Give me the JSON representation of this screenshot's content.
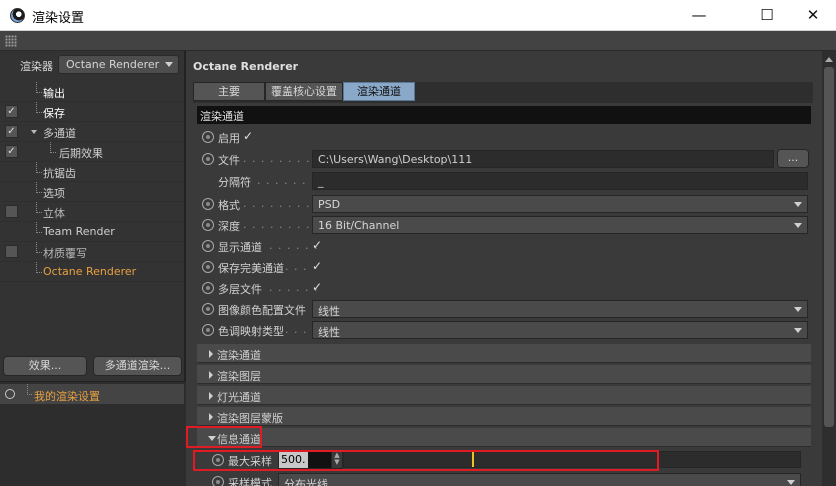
{
  "window": {
    "title": "渲染设置",
    "minimize": "—",
    "maximize": "☐",
    "close": "✕"
  },
  "left": {
    "renderer_label": "渲染器",
    "renderer_value": "Octane Renderer",
    "tree": [
      {
        "label": "输出",
        "checked": null,
        "state": "active"
      },
      {
        "label": "保存",
        "checked": true,
        "state": "active"
      },
      {
        "label": "多通道",
        "checked": true,
        "state": "normal"
      },
      {
        "label": "后期效果",
        "checked": true,
        "state": "normal"
      },
      {
        "label": "抗锯齿",
        "checked": null,
        "state": "normal"
      },
      {
        "label": "选项",
        "checked": null,
        "state": "normal"
      },
      {
        "label": "立体",
        "checked": false,
        "state": "normal"
      },
      {
        "label": "Team Render",
        "checked": null,
        "state": "normal"
      },
      {
        "label": "材质覆写",
        "checked": false,
        "state": "normal"
      },
      {
        "label": "Octane Renderer",
        "checked": null,
        "state": "orange"
      }
    ],
    "effects_button": "效果...",
    "multipass_button": "多通道渲染...",
    "settings_item": "我的渲染设置"
  },
  "right": {
    "header": "Octane Renderer",
    "tabs": [
      "主要",
      "覆盖核心设置",
      "渲染通道"
    ],
    "selected_tab": "渲染通道",
    "section_title": "渲染通道",
    "enable_label": "启用",
    "file_label": "文件",
    "file_dots": ". . . . . . . . . . .",
    "file_path": "C:\\Users\\Wang\\Desktop\\111",
    "browse_label": "...",
    "separator_label": "分隔符",
    "separator_dots": ". . . . . . . .",
    "separator_value": "_",
    "format_label": "格式",
    "format_dots": ". . . . . . . . . . .",
    "format_value": "PSD",
    "depth_label": "深度",
    "depth_dots": ". . . . . . . . . . .",
    "depth_value": "16 Bit/Channel",
    "show_passes_label": "显示通道",
    "show_passes_dots": ". . . . . .",
    "save_beauty_label": "保存完美通道",
    "save_beauty_dots": ". . .",
    "multilayer_label": "多层文件",
    "multilayer_dots": ". . . . . .",
    "color_profile_label": "图像颜色配置文件",
    "color_profile_value": "线性",
    "tonemap_label": "色调映射类型",
    "tonemap_dots": ". . .",
    "tonemap_value": "线性",
    "groups": [
      "渲染通道",
      "渲染图层",
      "灯光通道",
      "渲染图层蒙版",
      "信息通道"
    ],
    "max_samples_label": "最大采样",
    "max_samples_value": "500.",
    "max_samples_fraction": 0.28,
    "sampling_mode_label": "采样模式",
    "sampling_mode_value": "分布光线"
  },
  "colors": {
    "highlight": "#e01b24",
    "orange_text": "#e8a040",
    "selected_tab": "#8aa8c8",
    "slider_thumb": "#f0c020"
  }
}
